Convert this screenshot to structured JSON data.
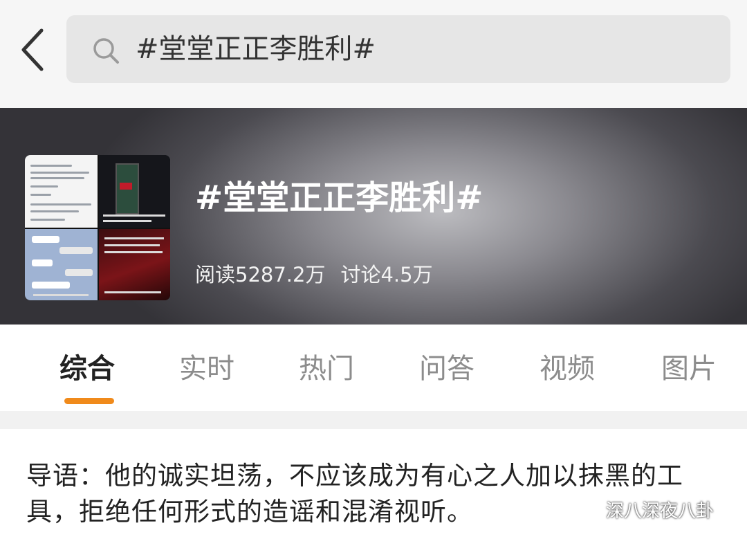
{
  "search": {
    "query": "#堂堂正正李胜利#"
  },
  "topic": {
    "title": "#堂堂正正李胜利#",
    "reads": "阅读5287.2万",
    "discussions": "讨论4.5万"
  },
  "tabs": [
    {
      "label": "综合",
      "active": true
    },
    {
      "label": "实时",
      "active": false
    },
    {
      "label": "热门",
      "active": false
    },
    {
      "label": "问答",
      "active": false
    },
    {
      "label": "视频",
      "active": false
    },
    {
      "label": "图片",
      "active": false
    }
  ],
  "lead": {
    "text": "导语：他的诚实坦荡，不应该成为有心之人加以抹黑的工具，拒绝任何形式的造谣和混淆视听。"
  },
  "watermark": {
    "text": "深八深夜八卦"
  },
  "colors": {
    "accent": "#f08a1b"
  }
}
